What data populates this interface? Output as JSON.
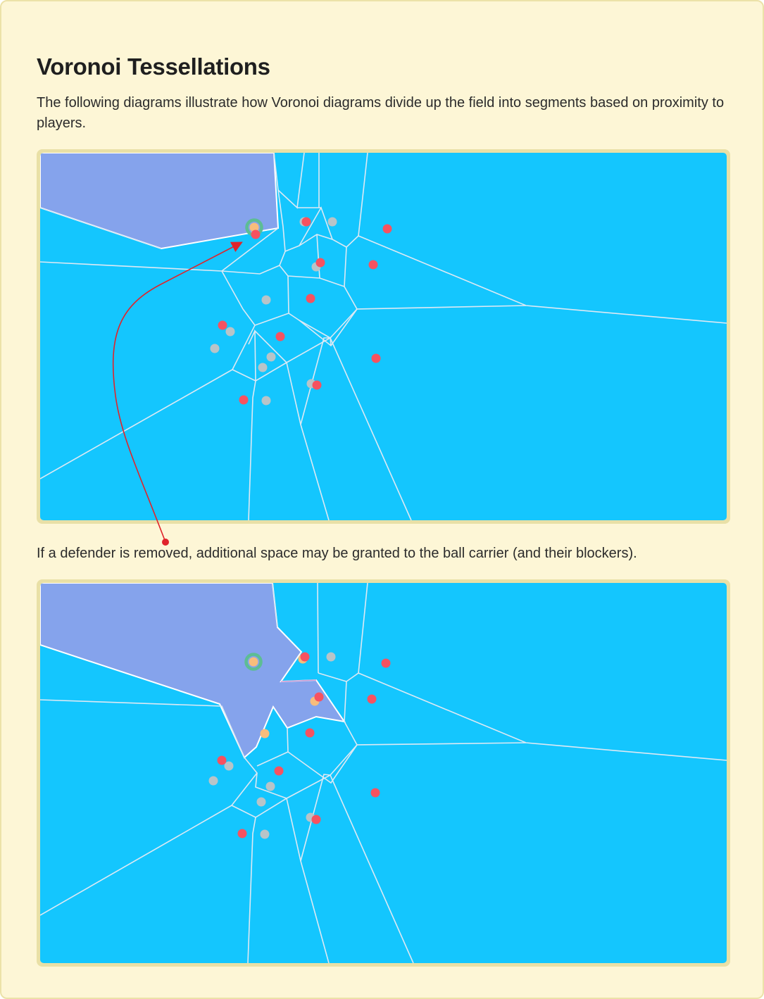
{
  "title": "Voronoi Tessellations",
  "intro": "The following diagrams illustrate how Voronoi diagrams divide up the field into segments based on proximity to players.",
  "caption": "If a defender is removed, additional space may be granted to the ball carrier (and their blockers).",
  "colors": {
    "card_background": "#fdf6d6",
    "figure_frame": "#e9e0a6",
    "field_cell": "#14c6fe",
    "carrier_region": "#85a3ec",
    "cell_edge": "#dde9f4",
    "defender": "#f65260",
    "offense_player": "#b8c4c8",
    "ball_carrier": "#f7bd7c",
    "ball_carrier_ring": "#5dbd94",
    "annotation_arrow": "#e0242b"
  }
}
